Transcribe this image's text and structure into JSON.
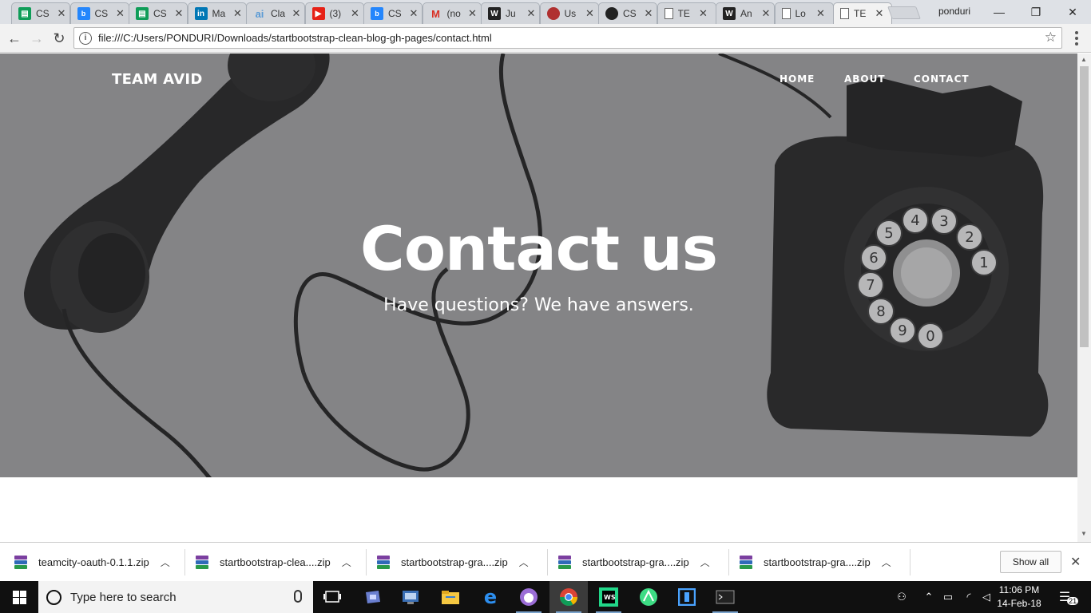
{
  "browser": {
    "tabs": [
      {
        "label": "CS",
        "icon": "sheets-icon",
        "color": "#0f9d58",
        "glyph": "▤"
      },
      {
        "label": "CS",
        "icon": "box-icon",
        "color": "#2486fc",
        "glyph": "box"
      },
      {
        "label": "CS",
        "icon": "sheets-icon",
        "color": "#0f9d58",
        "glyph": "▤"
      },
      {
        "label": "Ma",
        "icon": "linkedin-icon",
        "color": "#0077b5",
        "glyph": "in"
      },
      {
        "label": "Cla",
        "icon": "ai-icon",
        "color": "#5b9bd5",
        "glyph": "ai"
      },
      {
        "label": "(3)",
        "icon": "youtube-icon",
        "color": "#e62117",
        "glyph": "▶"
      },
      {
        "label": "CS",
        "icon": "box-icon",
        "color": "#2486fc",
        "glyph": "box"
      },
      {
        "label": "(no",
        "icon": "gmail-icon",
        "color": "#d93025",
        "glyph": "M"
      },
      {
        "label": "Ju",
        "icon": "webstorm-icon",
        "color": "#222222",
        "glyph": "WS"
      },
      {
        "label": "Us",
        "icon": "eye-icon",
        "color": "#b03030",
        "glyph": "◉"
      },
      {
        "label": "CS",
        "icon": "github-icon",
        "color": "#222222",
        "glyph": "●"
      },
      {
        "label": "TE",
        "icon": "page-icon",
        "color": "#888888",
        "glyph": "▯"
      },
      {
        "label": "An",
        "icon": "webstorm-icon",
        "color": "#222222",
        "glyph": "WS"
      },
      {
        "label": "Lo",
        "icon": "page-icon",
        "color": "#888888",
        "glyph": "▯"
      },
      {
        "label": "TE",
        "icon": "page-icon",
        "color": "#888888",
        "glyph": "▯",
        "active": true
      }
    ],
    "profile_name": "ponduri",
    "url": "file:///C:/Users/PONDURI/Downloads/startbootstrap-clean-blog-gh-pages/contact.html"
  },
  "page": {
    "brand": "TEAM AVID",
    "nav": [
      "HOME",
      "ABOUT",
      "CONTACT"
    ],
    "heading": "Contact us",
    "subheading": "Have questions? We have answers."
  },
  "downloads": {
    "items": [
      "teamcity-oauth-0.1.1.zip",
      "startbootstrap-clea....zip",
      "startbootstrap-gra....zip",
      "startbootstrap-gra....zip",
      "startbootstrap-gra....zip"
    ],
    "show_all": "Show all"
  },
  "taskbar": {
    "search_placeholder": "Type here to search",
    "time": "11:06 PM",
    "date": "14-Feb-18",
    "notification_count": "21"
  }
}
